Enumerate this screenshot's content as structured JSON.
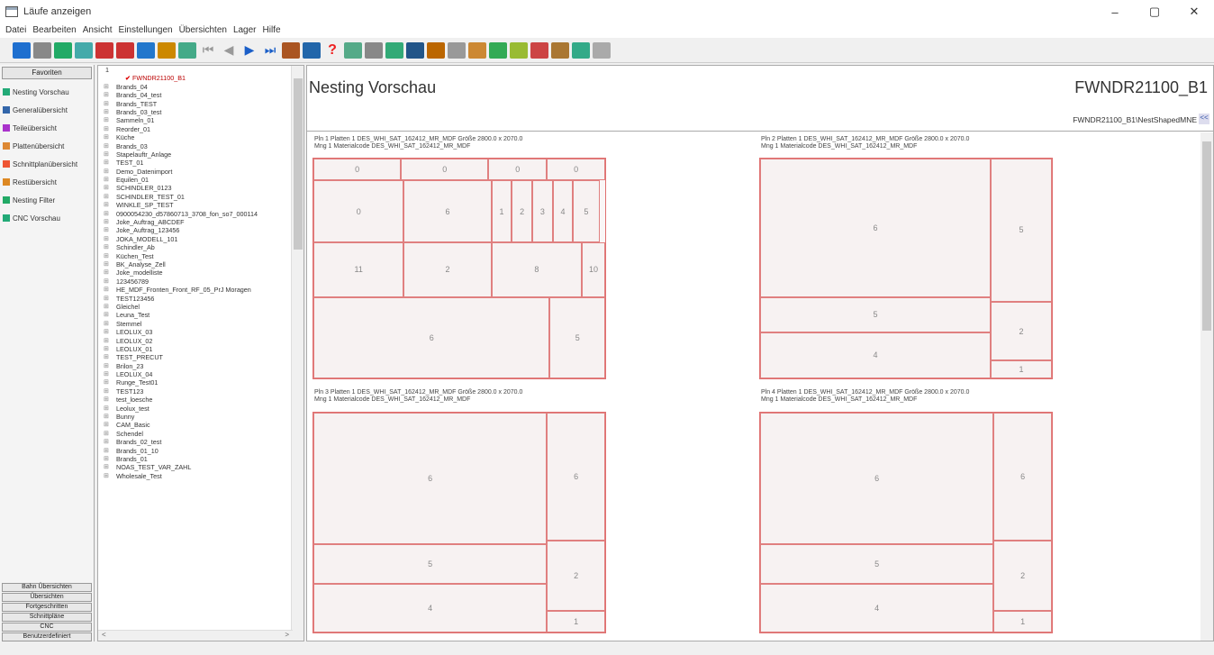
{
  "window": {
    "title": "Läufe anzeigen",
    "minimize": "–",
    "maximize": "▢",
    "close": "✕"
  },
  "menu": [
    "Datei",
    "Bearbeiten",
    "Ansicht",
    "Einstellungen",
    "Übersichten",
    "Lager",
    "Hilfe"
  ],
  "toolbar": {
    "icons": [
      "exit-icon",
      "list-icon",
      "tools-icon",
      "copy-icon",
      "import-icon",
      "cut-icon",
      "search-icon",
      "print-icon",
      "edit-icon",
      "first-icon",
      "prev-icon",
      "play-icon",
      "last-icon",
      "paint-icon",
      "arrow-icon",
      "help-icon",
      "monitor-icon",
      "page-icon",
      "label-icon",
      "chart-icon",
      "pencil-icon",
      "layout-icon",
      "boards-icon",
      "upload-icon",
      "list2-icon",
      "nest-icon",
      "parts-icon",
      "stack-icon",
      "cut2-icon"
    ],
    "colors": [
      "#1e6fcf",
      "#888",
      "#2a6",
      "#4aa",
      "#c33",
      "#c33",
      "#27c",
      "#c80",
      "#4a8",
      "#999",
      "#999",
      "#1b5fc8",
      "#1b5fc8",
      "#a52",
      "#26a",
      "#e22",
      "#5a8",
      "#888",
      "#3a7",
      "#258",
      "#b60",
      "#999",
      "#c83",
      "#3a5",
      "#9b3",
      "#c44",
      "#a73",
      "#3a8",
      "#aaa"
    ]
  },
  "sidebar": {
    "header": "Favoriten",
    "items": [
      {
        "label": "Nesting Vorschau",
        "color": "#2a7"
      },
      {
        "label": "Generalübersicht",
        "color": "#36a"
      },
      {
        "label": "Teileübersicht",
        "color": "#a3c"
      },
      {
        "label": "Plattenübersicht",
        "color": "#d83"
      },
      {
        "label": "Schnittplanübersicht",
        "color": "#e53"
      },
      {
        "label": "Restübersicht",
        "color": "#d82"
      },
      {
        "label": "Nesting Filter",
        "color": "#2a6"
      },
      {
        "label": "CNC Vorschau",
        "color": "#2a7"
      }
    ],
    "bottom_buttons": [
      "Bahn Übersichten",
      "Übersichten",
      "Fortgeschritten",
      "Schnittpläne",
      "CNC",
      "Benutzerdefiniert"
    ]
  },
  "tree": {
    "root": "1",
    "selected": "FWNDR21100_B1",
    "items": [
      "Brands_04",
      "Brands_04_test",
      "Brands_TEST",
      "Brands_03_test",
      "Sammeln_01",
      "Reorder_01",
      "Küche",
      "Brands_03",
      "Stapelauftr_Anlage",
      "TEST_01",
      "Demo_Datenimport",
      "Equilen_01",
      "SCHINDLER_0123",
      "SCHINDLER_TEST_01",
      "WINKLE_SP_TEST",
      "0900054230_d57860713_3708_fon_so7_000114",
      "Joke_Auftrag_ABCDEF",
      "Joke_Auftrag_123456",
      "JOKA_MODELL_101",
      "Schindler_Ab",
      "Küchen_Test",
      "BK_Analyse_Zell",
      "Joke_modelliste",
      "123456789",
      "HE_MDF_Fronten_Front_RF_05_PrJ Moragen",
      "TEST123456",
      "Gleichel",
      "Leuna_Test",
      "Stemmel",
      "LEOLUX_03",
      "LEOLUX_02",
      "LEOLUX_01",
      "TEST_PRECUT",
      "Brilon_23",
      "LEOLUX_04",
      "Runge_Test01",
      "TEST123",
      "test_loesche",
      "Leolux_test",
      "Bunny",
      "CAM_Basic",
      "Schendel",
      "Brands_02_test",
      "Brands_01_10",
      "Brands_01",
      "NOAS_TEST_VAR_ZAHL",
      "Wholesale_Test"
    ],
    "scroll_left": "<",
    "scroll_right": ">"
  },
  "main": {
    "title": "Nesting Vorschau",
    "job_id": "FWNDR21100_B1",
    "path": "FWNDR21100_B1\\NestShapedMNE",
    "path_button": "<<",
    "plates": [
      {
        "line1": "Pln 1  Platten 1 DES_WHI_SAT_162412_MR_MDF  Größe 2800.0 x 2070.0",
        "line2": "Mng 1  Materialcode DES_WHI_SAT_162412_MR_MDF",
        "parts": [
          {
            "n": "0"
          },
          {
            "n": "0"
          },
          {
            "n": "0"
          },
          {
            "n": "0"
          },
          {
            "n": "0"
          },
          {
            "n": "1"
          },
          {
            "n": "2"
          },
          {
            "n": "3"
          },
          {
            "n": "4"
          },
          {
            "n": "5"
          },
          {
            "n": "11"
          },
          {
            "n": "2"
          },
          {
            "n": "8"
          },
          {
            "n": "10"
          },
          {
            "n": "6"
          },
          {
            "n": "5"
          },
          {
            "n": "6"
          }
        ]
      },
      {
        "line1": "Pln 2  Platten 1 DES_WHI_SAT_162412_MR_MDF  Größe 2800.0 x 2070.0",
        "line2": "Mng 1  Materialcode DES_WHI_SAT_162412_MR_MDF",
        "parts": [
          {
            "n": "6"
          },
          {
            "n": "5"
          },
          {
            "n": "5"
          },
          {
            "n": "2"
          },
          {
            "n": "4"
          },
          {
            "n": "1"
          }
        ]
      },
      {
        "line1": "Pln 3  Platten 1 DES_WHI_SAT_162412_MR_MDF  Größe 2800.0 x 2070.0",
        "line2": "Mng 1  Materialcode DES_WHI_SAT_162412_MR_MDF",
        "parts": [
          {
            "n": "6"
          },
          {
            "n": "6"
          },
          {
            "n": "5"
          },
          {
            "n": "2"
          },
          {
            "n": "4"
          },
          {
            "n": "1"
          }
        ]
      },
      {
        "line1": "Pln 4  Platten 1 DES_WHI_SAT_162412_MR_MDF  Größe 2800.0 x 2070.0",
        "line2": "Mng 1  Materialcode DES_WHI_SAT_162412_MR_MDF",
        "parts": [
          {
            "n": "6"
          },
          {
            "n": "6"
          },
          {
            "n": "5"
          },
          {
            "n": "2"
          },
          {
            "n": "4"
          },
          {
            "n": "1"
          }
        ]
      }
    ]
  }
}
